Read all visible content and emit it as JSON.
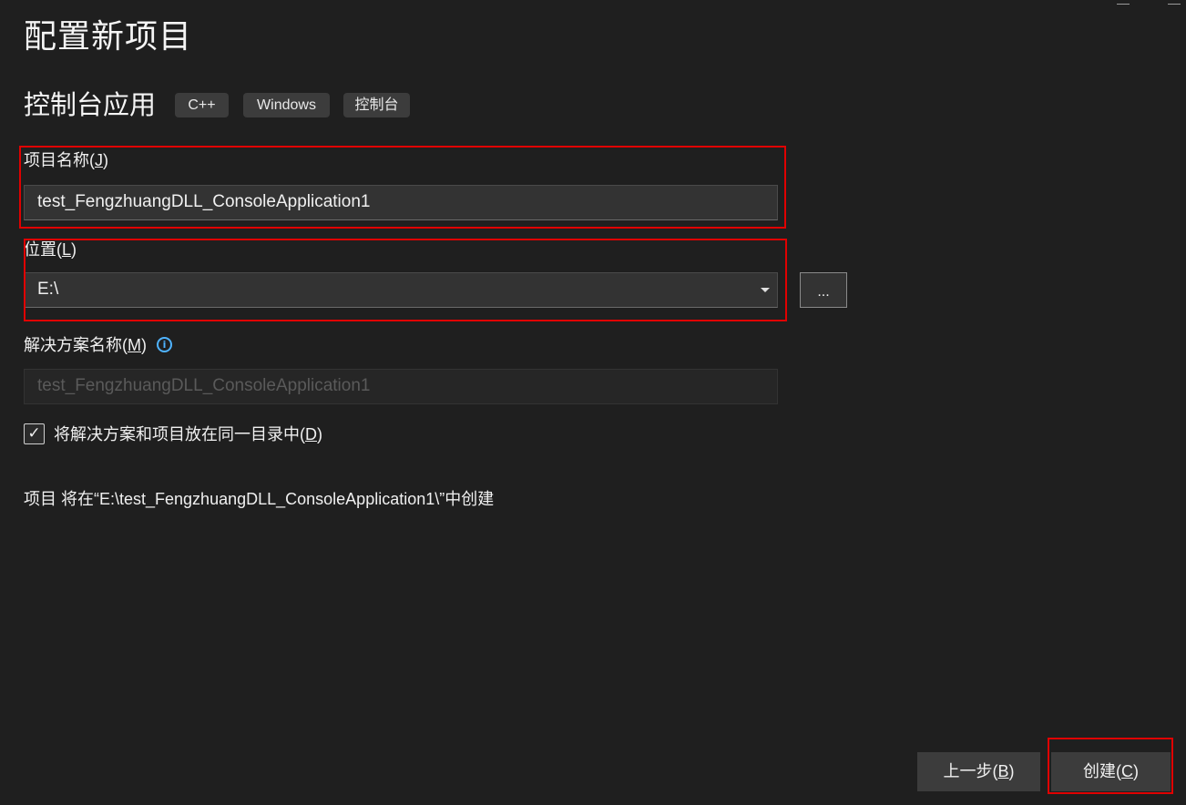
{
  "page": {
    "title": "配置新项目"
  },
  "template": {
    "name": "控制台应用",
    "tags": [
      "C++",
      "Windows",
      "控制台"
    ]
  },
  "project_name": {
    "label": "项目名称",
    "mnemonic": "J",
    "value": "test_FengzhuangDLL_ConsoleApplication1"
  },
  "location": {
    "label": "位置",
    "mnemonic": "L",
    "value": "E:\\",
    "browse_label": "...",
    "dropdown_icon": "chevron-down-icon"
  },
  "solution_name": {
    "label": "解决方案名称",
    "mnemonic": "M",
    "value": "test_FengzhuangDLL_ConsoleApplication1",
    "info_icon": "info-icon"
  },
  "same_dir": {
    "label": "将解决方案和项目放在同一目录中",
    "mnemonic": "D",
    "checked": true
  },
  "summary": {
    "text": "项目 将在“E:\\test_FengzhuangDLL_ConsoleApplication1\\”中创建"
  },
  "footer": {
    "back_label": "上一步",
    "back_mnemonic": "B",
    "create_label": "创建",
    "create_mnemonic": "C"
  },
  "colors": {
    "background": "#1f1f1f",
    "highlight_frame": "#e00000",
    "info_accent": "#4fb3ff"
  }
}
